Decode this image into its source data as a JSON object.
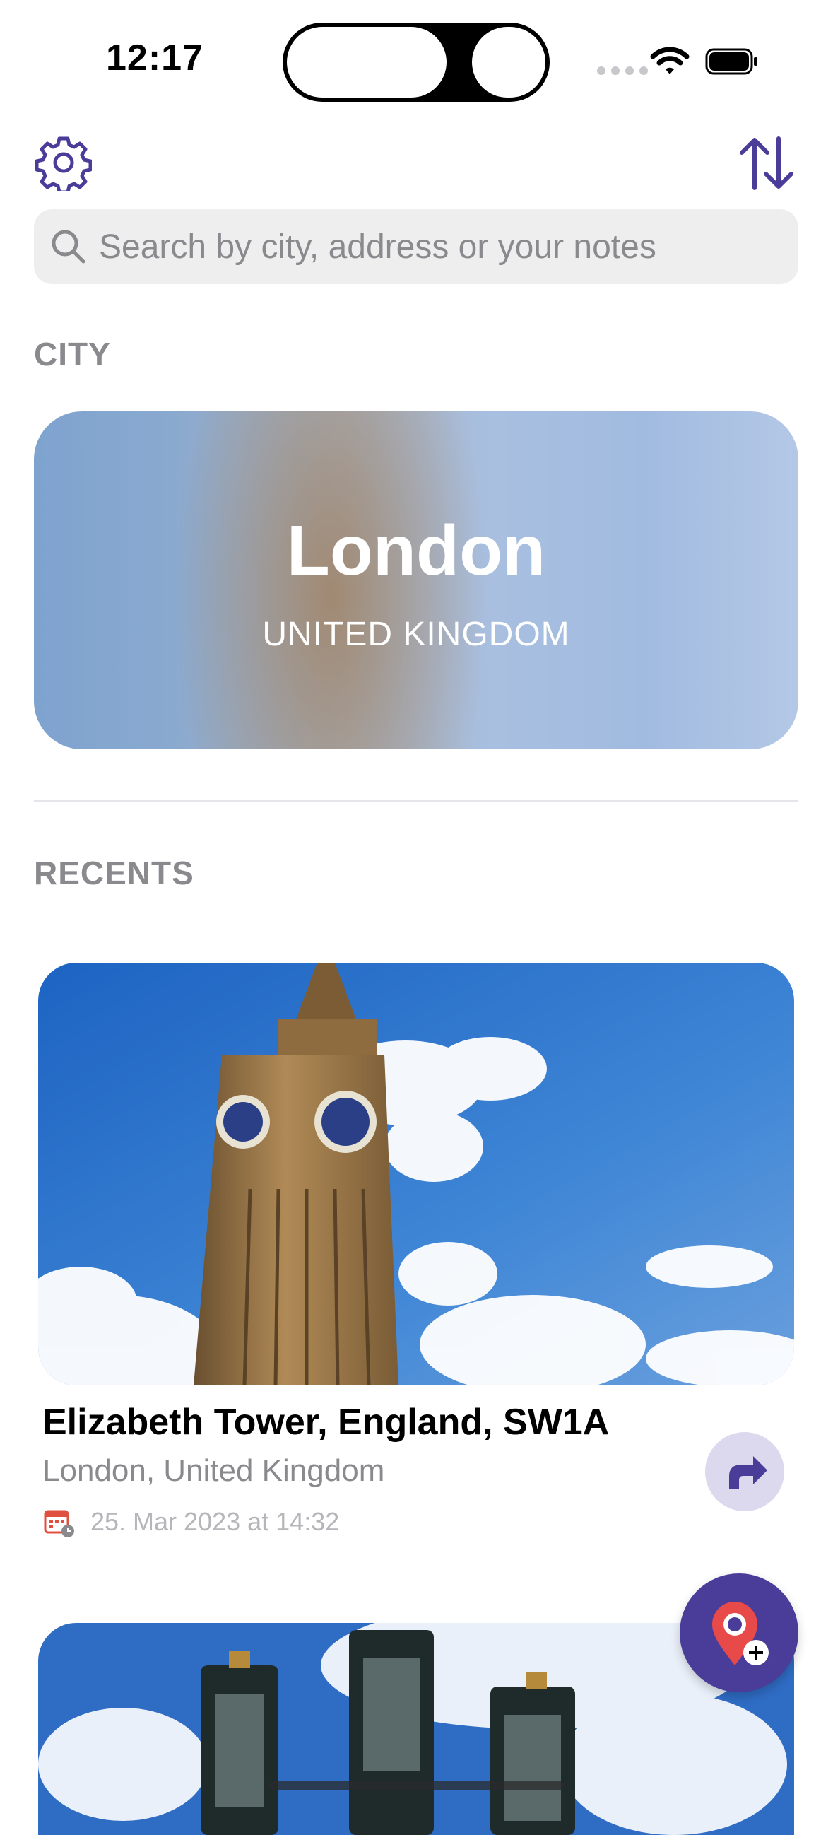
{
  "status_bar": {
    "time": "12:17"
  },
  "toolbar": {
    "settings_icon": "gear-icon",
    "sort_icon": "sort-arrows-icon"
  },
  "search": {
    "placeholder": "Search by city, address or your notes"
  },
  "city_section": {
    "header": "CITY",
    "card": {
      "city": "London",
      "country": "UNITED KINGDOM"
    }
  },
  "recents": {
    "header": "RECENTS",
    "items": [
      {
        "title": "Elizabeth Tower, England, SW1A",
        "subtitle": "London, United Kingdom",
        "date": "25. Mar 2023 at 14:32"
      }
    ]
  },
  "colors": {
    "accent": "#4a3d99",
    "accent_light": "#dcd8ee",
    "secondary_text": "#8a8a8e"
  }
}
